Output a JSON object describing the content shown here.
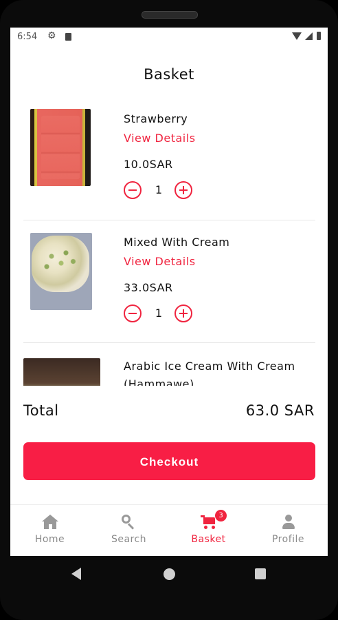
{
  "status_bar": {
    "time": "6:54"
  },
  "header": {
    "title": "Basket"
  },
  "basket": {
    "items": [
      {
        "name": "Strawberry",
        "details_link": "View Details",
        "price": "10.0SAR",
        "quantity": "1"
      },
      {
        "name": "Mixed With Cream",
        "details_link": "View Details",
        "price": "33.0SAR",
        "quantity": "1"
      },
      {
        "name": "Arabic Ice Cream With Cream",
        "name_line2": "(Hammawe)"
      }
    ]
  },
  "summary": {
    "total_label": "Total",
    "total_value": "63.0 SAR"
  },
  "checkout": {
    "label": "Checkout"
  },
  "bottom_nav": {
    "items": [
      {
        "label": "Home",
        "icon": "home-icon",
        "active": false
      },
      {
        "label": "Search",
        "icon": "search-icon",
        "active": false
      },
      {
        "label": "Basket",
        "icon": "cart-icon",
        "active": true,
        "badge": "3"
      },
      {
        "label": "Profile",
        "icon": "person-icon",
        "active": false
      }
    ]
  },
  "colors": {
    "accent": "#f81e45",
    "text": "#111111",
    "inactive": "#8a8a8a"
  }
}
